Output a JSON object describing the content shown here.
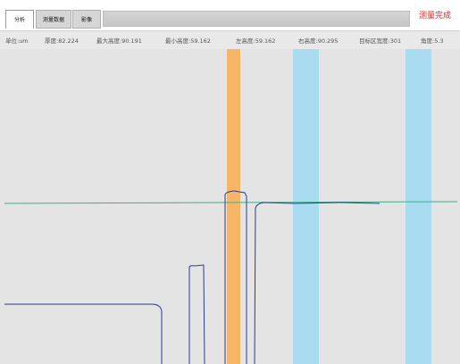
{
  "tabs": [
    {
      "label": "分析"
    },
    {
      "label": "测量数据"
    },
    {
      "label": "影像"
    }
  ],
  "status": {
    "text": "测量完成",
    "color": "#d42020"
  },
  "info": {
    "unit": "单位:um",
    "thickness": "厚度:82.224",
    "max_height": "最大高度:90.191",
    "min_height": "最小高度:59.162",
    "left_height": "左高度:59.162",
    "right_height": "右高度:90.295",
    "target_width": "目标区宽度:301",
    "angle": "角度:5.3"
  },
  "plot": {
    "background": "#e4e4e4",
    "reference_line_color": "#3fae8a",
    "profile_color": "#2c3a8a",
    "orange_band_color": "#f7b667",
    "blue_band_color": "#a9dcf0"
  }
}
